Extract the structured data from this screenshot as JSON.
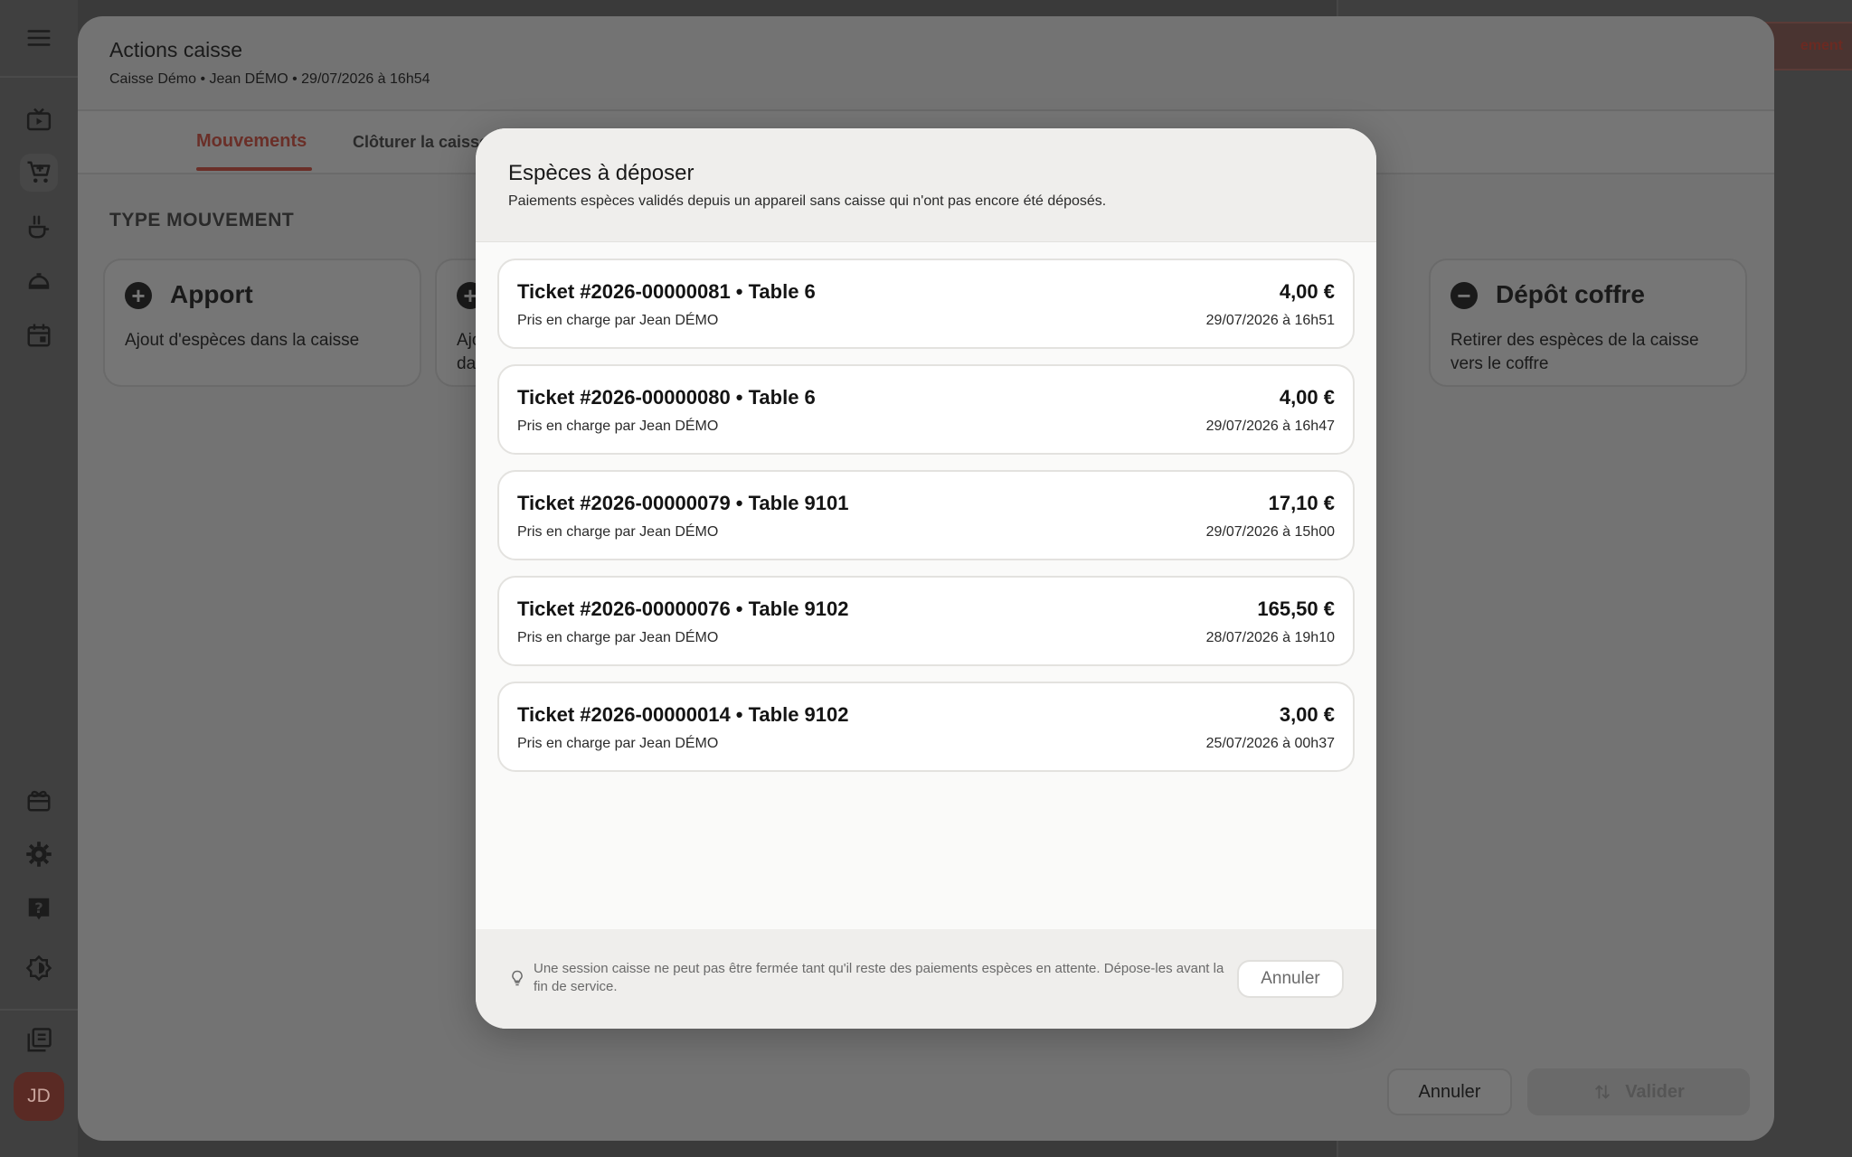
{
  "background": {
    "right_pill_label": "ement"
  },
  "sheet": {
    "title": "Actions caisse",
    "subtitle": "Caisse Démo • Jean DÉMO • 29/07/2026 à 16h54",
    "tabs": [
      {
        "label": "Mouvements",
        "active": true
      },
      {
        "label": "Clôturer la caisse",
        "active": false
      }
    ],
    "type_label": "TYPE MOUVEMENT",
    "cards": [
      {
        "icon": "plus-circle-icon",
        "title": "Apport",
        "desc": "Ajout d'espèces dans la caisse"
      },
      {
        "icon": "plus-circle-icon",
        "title": "",
        "desc": "Ajo\nda"
      },
      {
        "icon": "minus-circle-icon",
        "title": "Dépôt coffre",
        "desc": "Retirer des espèces de la caisse vers le coffre"
      }
    ],
    "cancel_label": "Annuler",
    "validate_label": "Valider"
  },
  "user": {
    "initials": "JD"
  },
  "modal": {
    "title": "Espèces à déposer",
    "subtitle": "Paiements espèces validés depuis un appareil sans caisse qui n'ont pas encore été déposés.",
    "tickets": [
      {
        "title": "Ticket #2026-00000081 • Table 6",
        "handled_by": "Pris en charge par Jean DÉMO",
        "amount": "4,00 €",
        "date": "29/07/2026 à 16h51"
      },
      {
        "title": "Ticket #2026-00000080 • Table 6",
        "handled_by": "Pris en charge par Jean DÉMO",
        "amount": "4,00 €",
        "date": "29/07/2026 à 16h47"
      },
      {
        "title": "Ticket #2026-00000079 • Table 9101",
        "handled_by": "Pris en charge par Jean DÉMO",
        "amount": "17,10 €",
        "date": "29/07/2026 à 15h00"
      },
      {
        "title": "Ticket #2026-00000076 • Table 9102",
        "handled_by": "Pris en charge par Jean DÉMO",
        "amount": "165,50 €",
        "date": "28/07/2026 à 19h10"
      },
      {
        "title": "Ticket #2026-00000014 • Table 9102",
        "handled_by": "Pris en charge par Jean DÉMO",
        "amount": "3,00 €",
        "date": "25/07/2026 à 00h37"
      }
    ],
    "footer_note": "Une session caisse ne peut pas être fermée tant qu'il reste des paiements espèces en attente. Dépose-les avant la fin de service.",
    "cancel_label": "Annuler"
  }
}
